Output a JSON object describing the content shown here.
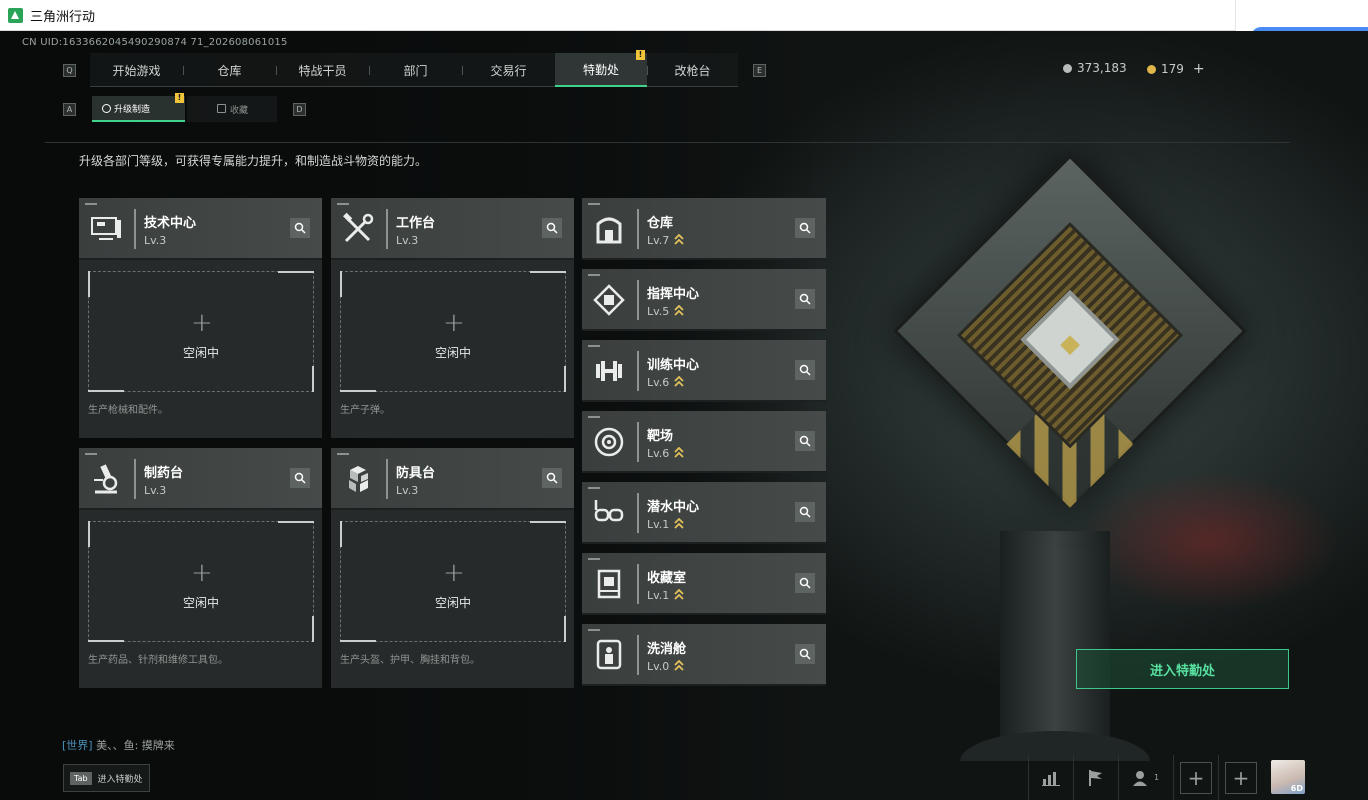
{
  "window": {
    "title": "三角洲行动"
  },
  "uid_text": "CN UID:1633662045490290874 71_202608061015",
  "nav": {
    "left_key": "Q",
    "right_key": "E",
    "tabs": [
      {
        "label": "开始游戏",
        "active": false
      },
      {
        "label": "仓库",
        "active": false
      },
      {
        "label": "特战干员",
        "active": false
      },
      {
        "label": "部门",
        "active": false
      },
      {
        "label": "交易行",
        "active": false
      },
      {
        "label": "特勤处",
        "active": true,
        "badge": "!"
      },
      {
        "label": "改枪台",
        "active": false
      }
    ]
  },
  "currency": [
    {
      "value": "373,183",
      "color": "#b8bcbb"
    },
    {
      "value": "179",
      "color": "#e0b64a",
      "add": "+"
    }
  ],
  "subtabs": {
    "left_key": "A",
    "right_key": "D",
    "items": [
      {
        "label": "升级制造",
        "active": true,
        "badge": "!"
      },
      {
        "label": "收藏",
        "active": false
      }
    ]
  },
  "description": "升级各部门等级，可获得专属能力提升，和制造战斗物资的能力。",
  "idle_text": "空闲中",
  "plus_glyph": "+",
  "production": [
    {
      "name": "技术中心",
      "level": "Lv.3",
      "icon": "computer-icon",
      "footer": "生产枪械和配件。"
    },
    {
      "name": "工作台",
      "level": "Lv.3",
      "icon": "tools-icon",
      "footer": "生产子弹。"
    },
    {
      "name": "制药台",
      "level": "Lv.3",
      "icon": "microscope-icon",
      "footer": "生产药品、针剂和维修工具包。"
    },
    {
      "name": "防具台",
      "level": "Lv.3",
      "icon": "blocks-icon",
      "footer": "生产头盔、护甲、胸挂和背包。"
    }
  ],
  "facilities": [
    {
      "name": "仓库",
      "level": "Lv.7",
      "icon": "warehouse-icon"
    },
    {
      "name": "指挥中心",
      "level": "Lv.5",
      "icon": "chip-icon"
    },
    {
      "name": "训练中心",
      "level": "Lv.6",
      "icon": "dumbbell-icon"
    },
    {
      "name": "靶场",
      "level": "Lv.6",
      "icon": "target-icon"
    },
    {
      "name": "潜水中心",
      "level": "Lv.1",
      "icon": "diving-mask-icon"
    },
    {
      "name": "收藏室",
      "level": "Lv.1",
      "icon": "display-case-icon"
    },
    {
      "name": "洗消舱",
      "level": "Lv.0",
      "icon": "decon-pod-icon"
    }
  ],
  "upgrade_color": "#e3c15a",
  "accent_color": "#3ed38a",
  "enter_button": "进入特勤处",
  "chat": {
    "channel": "[世界]",
    "text": "美、、鱼: 摸牌来"
  },
  "tab_hint": {
    "key": "Tab",
    "label": "进入特勤处"
  },
  "bottom_bar": {
    "friends_count": "1",
    "avatar_level": "6D"
  }
}
